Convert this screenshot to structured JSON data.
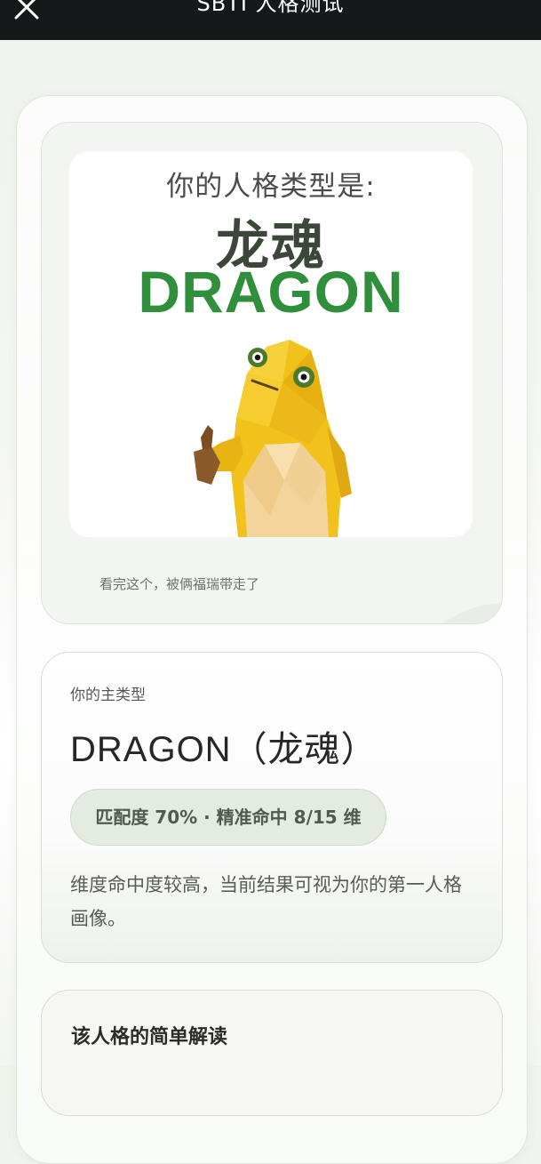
{
  "header": {
    "title": "SBTI 人格测试",
    "close_icon": "close-icon"
  },
  "hero": {
    "prompt": "你的人格类型是:",
    "type_cn": "龙魂",
    "type_en": "DRAGON",
    "caption": "看完这个，被俩福瑞带走了",
    "mascot": "yellow-lowpoly-creature-thumbs-up"
  },
  "main_type": {
    "label": "你的主类型",
    "value": "DRAGON（龙魂）",
    "badge": "匹配度 70% · 精准命中 8/15 维",
    "description": "维度命中度较高，当前结果可视为你的第一人格画像。"
  },
  "brief": {
    "title": "该人格的简单解读"
  },
  "colors": {
    "accent_green": "#2f8f3b",
    "header_bg": "#16181a",
    "badge_bg": "#e4ebe1"
  }
}
